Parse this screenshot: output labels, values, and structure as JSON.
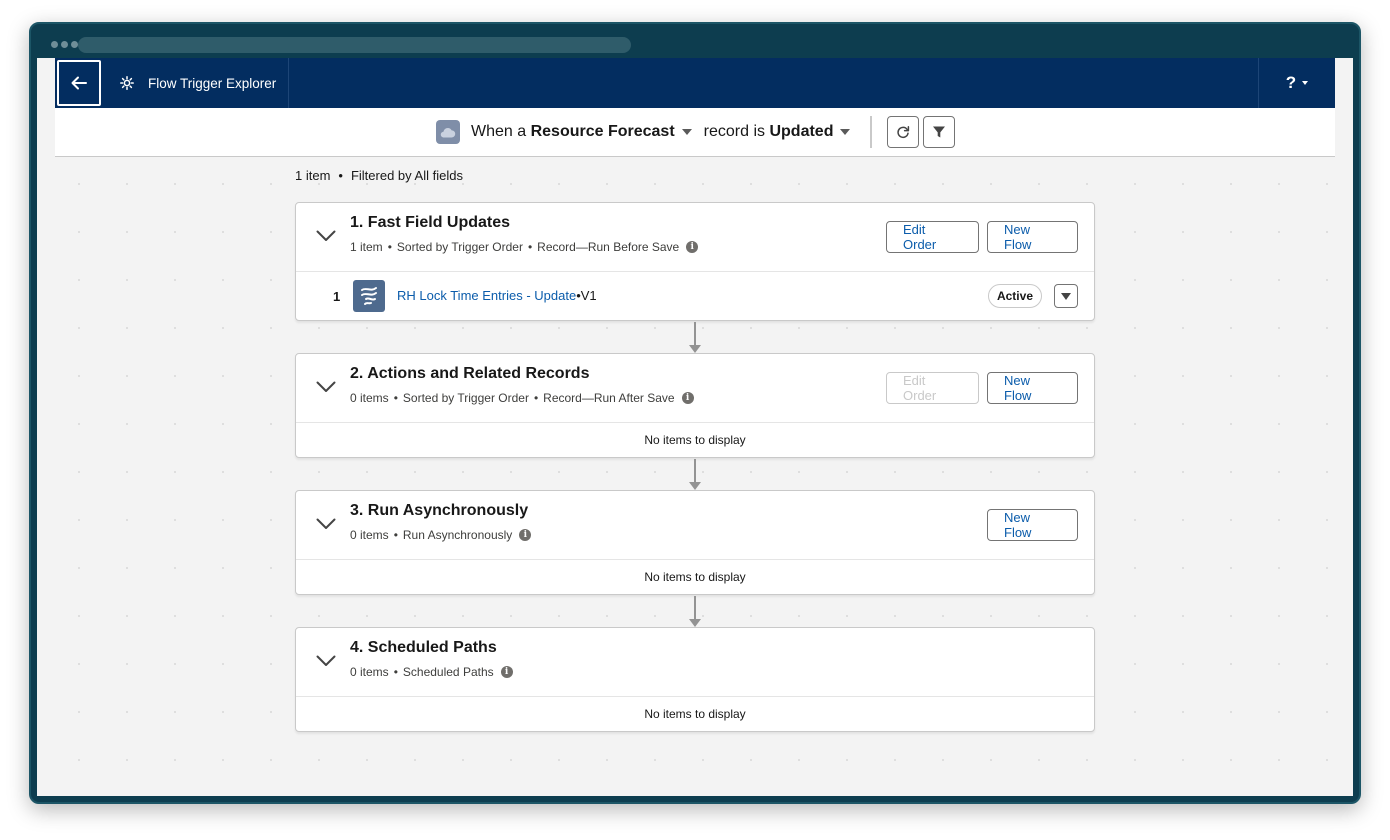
{
  "app": {
    "title": "Flow Trigger Explorer",
    "help_label": "?"
  },
  "trigger": {
    "prefix": "When a",
    "object": "Resource Forecast",
    "middle": "record is",
    "event": "Updated"
  },
  "summary": {
    "count": "1 item",
    "bullet": "•",
    "filter": "Filtered by All fields"
  },
  "sections": [
    {
      "title": "1. Fast Field Updates",
      "count": "1 item",
      "sort": "Sorted by Trigger Order",
      "type": "Record—Run Before Save",
      "edit_order_label": "Edit Order",
      "new_flow_label": "New Flow",
      "rows": [
        {
          "index": "1",
          "name": "RH Lock Time Entries - Update",
          "version": "•V1",
          "status": "Active"
        }
      ]
    },
    {
      "title": "2. Actions and Related Records",
      "count": "0 items",
      "sort": "Sorted by Trigger Order",
      "type": "Record—Run After Save",
      "edit_order_label": "Edit Order",
      "new_flow_label": "New Flow",
      "empty_text": "No items to display"
    },
    {
      "title": "3. Run Asynchronously",
      "count": "0 items",
      "type": "Run Asynchronously",
      "new_flow_label": "New Flow",
      "empty_text": "No items to display"
    },
    {
      "title": "4. Scheduled Paths",
      "count": "0 items",
      "type": "Scheduled Paths",
      "empty_text": "No items to display"
    }
  ],
  "meta_bullet": "•",
  "icons": {
    "back": "arrow-left-icon",
    "app": "gear-icon",
    "object": "cloud-icon",
    "refresh": "refresh-icon",
    "filter": "filter-icon",
    "chevron": "chevron-down-icon",
    "info": "info-icon",
    "flow": "flow-icon"
  },
  "colors": {
    "nav_bg": "#032d60",
    "link": "#0b5cab",
    "frame": "#0d3d4f"
  }
}
